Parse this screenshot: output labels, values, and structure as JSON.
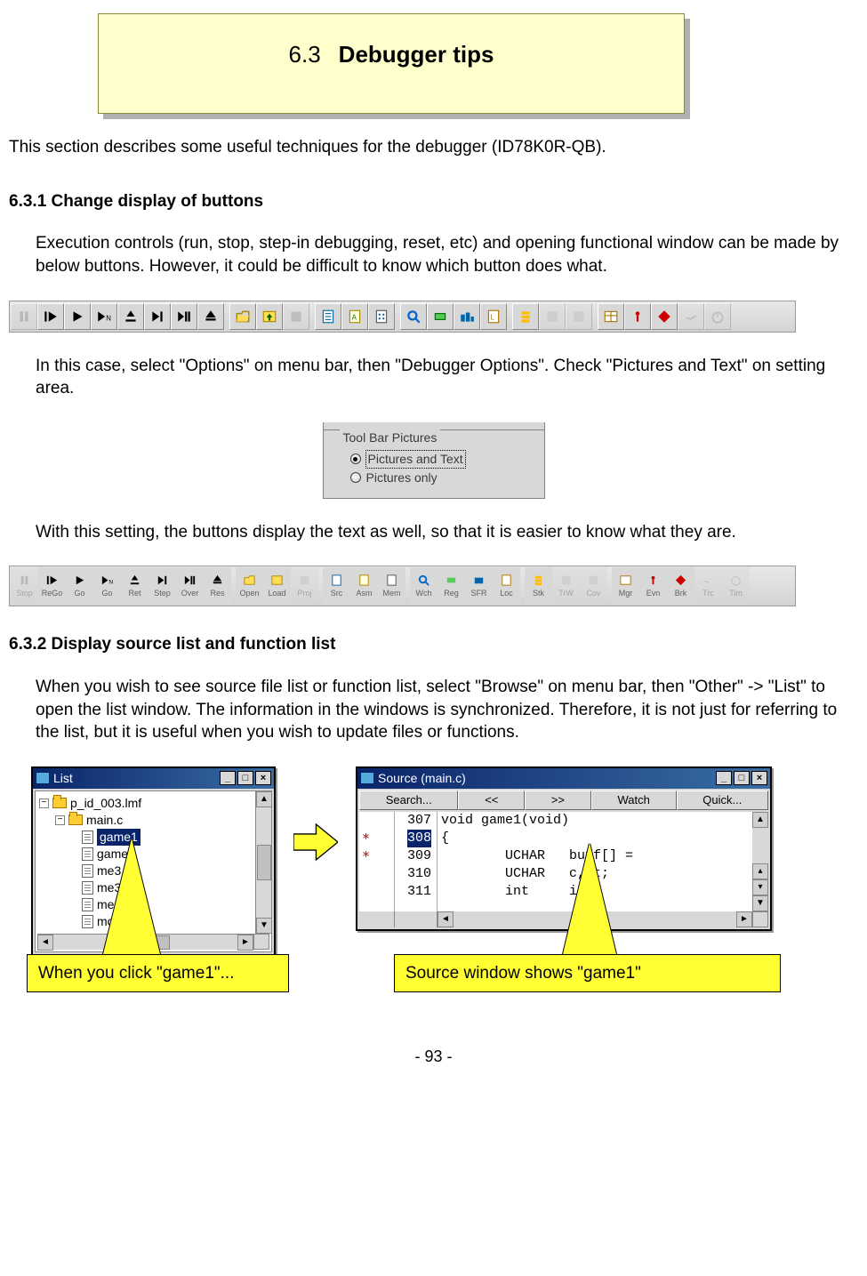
{
  "title": {
    "num": "6.3",
    "text": "Debugger tips"
  },
  "intro": "This section describes some useful techniques for the debugger (ID78K0R-QB).",
  "s631": {
    "heading": "6.3.1 Change display of buttons",
    "p1": "Execution controls (run, stop, step-in debugging, reset, etc) and opening functional window can be made by below buttons. However, it could be difficult to know which button does what.",
    "p2": "In this case, select \"Options\" on menu bar, then \"Debugger Options\". Check \"Pictures and Text\" on setting area.",
    "p3": "With this setting, the buttons display the text as well, so that it is easier to know what they are."
  },
  "opt": {
    "legend": "Tool Bar Pictures",
    "r1": "Pictures and Text",
    "r2": "Pictures only"
  },
  "tb2": {
    "b0": "Stop",
    "b1": "ReGo",
    "b2": "Go",
    "b3": "Go",
    "b4": "Ret",
    "b5": "Step",
    "b6": "Over",
    "b7": "Res",
    "b8": "Open",
    "b9": "Load",
    "b10": "Proj",
    "b11": "Src",
    "b12": "Asm",
    "b13": "Mem",
    "b14": "Wch",
    "b15": "Reg",
    "b16": "SFR",
    "b17": "Loc",
    "b18": "Stk",
    "b19": "TrW",
    "b20": "Cov",
    "b21": "Mgr",
    "b22": "Evn",
    "b23": "Brk",
    "b24": "Trc",
    "b25": "Tim"
  },
  "s632": {
    "heading": "6.3.2 Display source list and function list",
    "p1": "When you wish to see source file list or function list, select \"Browse\" on menu bar, then \"Other\" -> \"List\" to open the list window. The information in the windows is synchronized. Therefore, it is not just for referring to the list, but it is useful when you wish to update files or functions."
  },
  "list_window": {
    "title": "List",
    "tree": {
      "root": "p_id_003.lmf",
      "file": "main.c",
      "items": [
        "game1",
        "game2",
        "me3",
        "me3Init",
        "me4",
        "mo5"
      ]
    }
  },
  "src_window": {
    "title": "Source (main.c)",
    "buttons": {
      "search": "Search...",
      "prev": "<<",
      "next": ">>",
      "watch": "Watch",
      "quick": "Quick..."
    },
    "lines": [
      "307",
      "308",
      "309",
      "310",
      "311"
    ],
    "code": {
      "l307": "void game1(void)",
      "l308": "{",
      "l309": "        UCHAR   buff[] =",
      "l310": "        UCHAR   c, t;",
      "l311": "        int     i;"
    },
    "gutter_marks": [
      "",
      "*",
      "*",
      "",
      ""
    ]
  },
  "callouts": {
    "c1": "When you click \"game1\"...",
    "c2": "Source window shows \"game1\""
  },
  "footer": "- 93 -"
}
